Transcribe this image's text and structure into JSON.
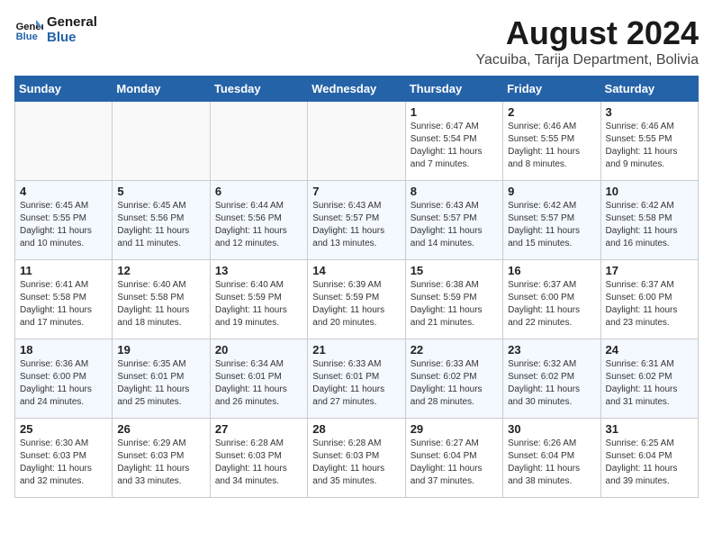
{
  "logo": {
    "line1": "General",
    "line2": "Blue"
  },
  "title": "August 2024",
  "location": "Yacuiba, Tarija Department, Bolivia",
  "weekdays": [
    "Sunday",
    "Monday",
    "Tuesday",
    "Wednesday",
    "Thursday",
    "Friday",
    "Saturday"
  ],
  "weeks": [
    [
      {
        "day": "",
        "info": ""
      },
      {
        "day": "",
        "info": ""
      },
      {
        "day": "",
        "info": ""
      },
      {
        "day": "",
        "info": ""
      },
      {
        "day": "1",
        "info": "Sunrise: 6:47 AM\nSunset: 5:54 PM\nDaylight: 11 hours\nand 7 minutes."
      },
      {
        "day": "2",
        "info": "Sunrise: 6:46 AM\nSunset: 5:55 PM\nDaylight: 11 hours\nand 8 minutes."
      },
      {
        "day": "3",
        "info": "Sunrise: 6:46 AM\nSunset: 5:55 PM\nDaylight: 11 hours\nand 9 minutes."
      }
    ],
    [
      {
        "day": "4",
        "info": "Sunrise: 6:45 AM\nSunset: 5:55 PM\nDaylight: 11 hours\nand 10 minutes."
      },
      {
        "day": "5",
        "info": "Sunrise: 6:45 AM\nSunset: 5:56 PM\nDaylight: 11 hours\nand 11 minutes."
      },
      {
        "day": "6",
        "info": "Sunrise: 6:44 AM\nSunset: 5:56 PM\nDaylight: 11 hours\nand 12 minutes."
      },
      {
        "day": "7",
        "info": "Sunrise: 6:43 AM\nSunset: 5:57 PM\nDaylight: 11 hours\nand 13 minutes."
      },
      {
        "day": "8",
        "info": "Sunrise: 6:43 AM\nSunset: 5:57 PM\nDaylight: 11 hours\nand 14 minutes."
      },
      {
        "day": "9",
        "info": "Sunrise: 6:42 AM\nSunset: 5:57 PM\nDaylight: 11 hours\nand 15 minutes."
      },
      {
        "day": "10",
        "info": "Sunrise: 6:42 AM\nSunset: 5:58 PM\nDaylight: 11 hours\nand 16 minutes."
      }
    ],
    [
      {
        "day": "11",
        "info": "Sunrise: 6:41 AM\nSunset: 5:58 PM\nDaylight: 11 hours\nand 17 minutes."
      },
      {
        "day": "12",
        "info": "Sunrise: 6:40 AM\nSunset: 5:58 PM\nDaylight: 11 hours\nand 18 minutes."
      },
      {
        "day": "13",
        "info": "Sunrise: 6:40 AM\nSunset: 5:59 PM\nDaylight: 11 hours\nand 19 minutes."
      },
      {
        "day": "14",
        "info": "Sunrise: 6:39 AM\nSunset: 5:59 PM\nDaylight: 11 hours\nand 20 minutes."
      },
      {
        "day": "15",
        "info": "Sunrise: 6:38 AM\nSunset: 5:59 PM\nDaylight: 11 hours\nand 21 minutes."
      },
      {
        "day": "16",
        "info": "Sunrise: 6:37 AM\nSunset: 6:00 PM\nDaylight: 11 hours\nand 22 minutes."
      },
      {
        "day": "17",
        "info": "Sunrise: 6:37 AM\nSunset: 6:00 PM\nDaylight: 11 hours\nand 23 minutes."
      }
    ],
    [
      {
        "day": "18",
        "info": "Sunrise: 6:36 AM\nSunset: 6:00 PM\nDaylight: 11 hours\nand 24 minutes."
      },
      {
        "day": "19",
        "info": "Sunrise: 6:35 AM\nSunset: 6:01 PM\nDaylight: 11 hours\nand 25 minutes."
      },
      {
        "day": "20",
        "info": "Sunrise: 6:34 AM\nSunset: 6:01 PM\nDaylight: 11 hours\nand 26 minutes."
      },
      {
        "day": "21",
        "info": "Sunrise: 6:33 AM\nSunset: 6:01 PM\nDaylight: 11 hours\nand 27 minutes."
      },
      {
        "day": "22",
        "info": "Sunrise: 6:33 AM\nSunset: 6:02 PM\nDaylight: 11 hours\nand 28 minutes."
      },
      {
        "day": "23",
        "info": "Sunrise: 6:32 AM\nSunset: 6:02 PM\nDaylight: 11 hours\nand 30 minutes."
      },
      {
        "day": "24",
        "info": "Sunrise: 6:31 AM\nSunset: 6:02 PM\nDaylight: 11 hours\nand 31 minutes."
      }
    ],
    [
      {
        "day": "25",
        "info": "Sunrise: 6:30 AM\nSunset: 6:03 PM\nDaylight: 11 hours\nand 32 minutes."
      },
      {
        "day": "26",
        "info": "Sunrise: 6:29 AM\nSunset: 6:03 PM\nDaylight: 11 hours\nand 33 minutes."
      },
      {
        "day": "27",
        "info": "Sunrise: 6:28 AM\nSunset: 6:03 PM\nDaylight: 11 hours\nand 34 minutes."
      },
      {
        "day": "28",
        "info": "Sunrise: 6:28 AM\nSunset: 6:03 PM\nDaylight: 11 hours\nand 35 minutes."
      },
      {
        "day": "29",
        "info": "Sunrise: 6:27 AM\nSunset: 6:04 PM\nDaylight: 11 hours\nand 37 minutes."
      },
      {
        "day": "30",
        "info": "Sunrise: 6:26 AM\nSunset: 6:04 PM\nDaylight: 11 hours\nand 38 minutes."
      },
      {
        "day": "31",
        "info": "Sunrise: 6:25 AM\nSunset: 6:04 PM\nDaylight: 11 hours\nand 39 minutes."
      }
    ]
  ]
}
